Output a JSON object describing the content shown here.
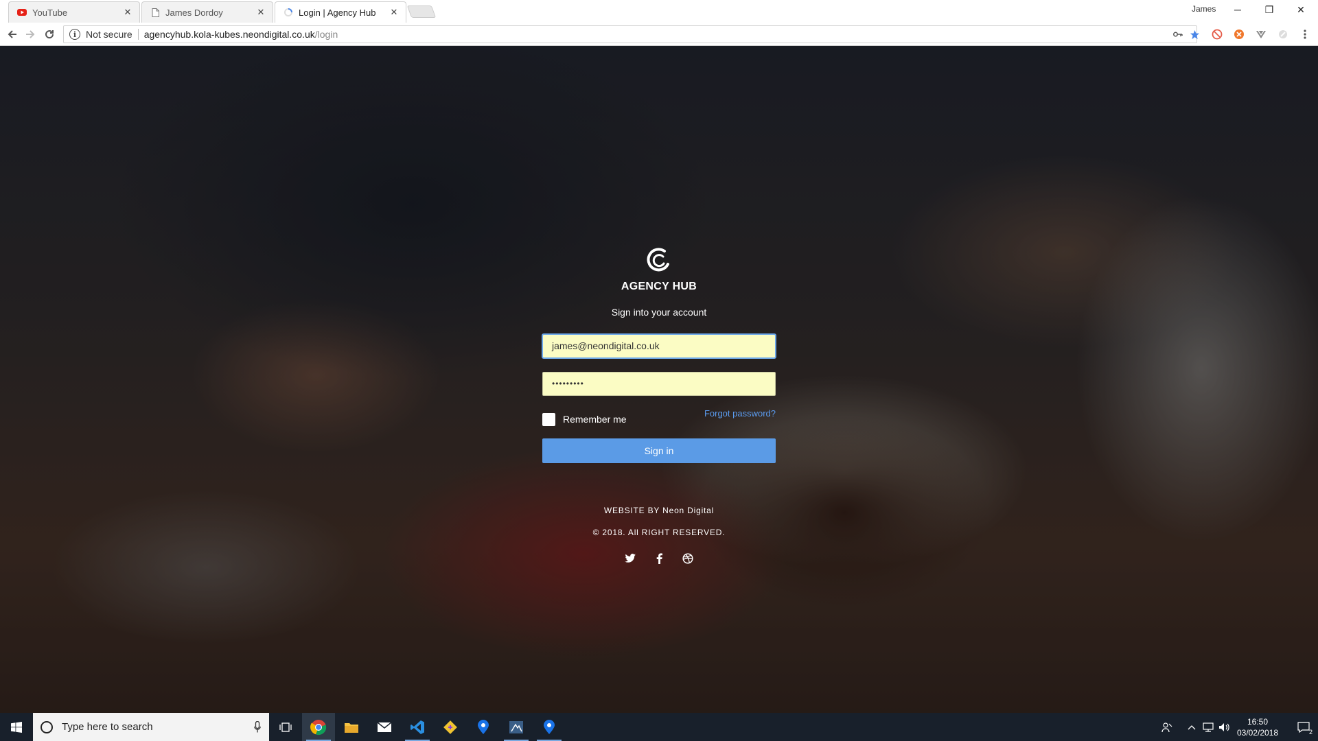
{
  "browser": {
    "tabs": [
      {
        "title": "YouTube",
        "icon": "youtube-icon"
      },
      {
        "title": "James Dordoy",
        "icon": "page-icon"
      },
      {
        "title": "Login | Agency Hub",
        "icon": "loading-icon",
        "active": true
      }
    ],
    "profile_name": "James",
    "address": {
      "security_label": "Not secure",
      "host": "agencyhub.kola-kubes.neondigital.co.uk",
      "path": "/login"
    }
  },
  "login": {
    "brand": "AGENCY HUB",
    "subtitle": "Sign into your account",
    "email_value": "james@neondigital.co.uk",
    "password_value": "•••••••••",
    "remember_label": "Remember me",
    "forgot_label": "Forgot password?",
    "signin_label": "Sign in",
    "credit": "WEBSITE BY Neon Digital",
    "copyright": "© 2018. All RIGHT RESERVED.",
    "socials": [
      "twitter-icon",
      "facebook-icon",
      "dribbble-icon"
    ]
  },
  "taskbar": {
    "search_placeholder": "Type here to search",
    "time": "16:50",
    "date": "03/02/2018",
    "notification_count": "2",
    "apps": [
      "task-view-icon",
      "chrome-icon",
      "file-explorer-icon",
      "mail-icon",
      "vscode-icon",
      "git-icon",
      "maps-icon",
      "app-icon",
      "maps-icon"
    ]
  },
  "colors": {
    "accent": "#5b9be6",
    "link": "#5b9cf0",
    "autofill": "#fbfcc4",
    "taskbar": "#18202b"
  }
}
